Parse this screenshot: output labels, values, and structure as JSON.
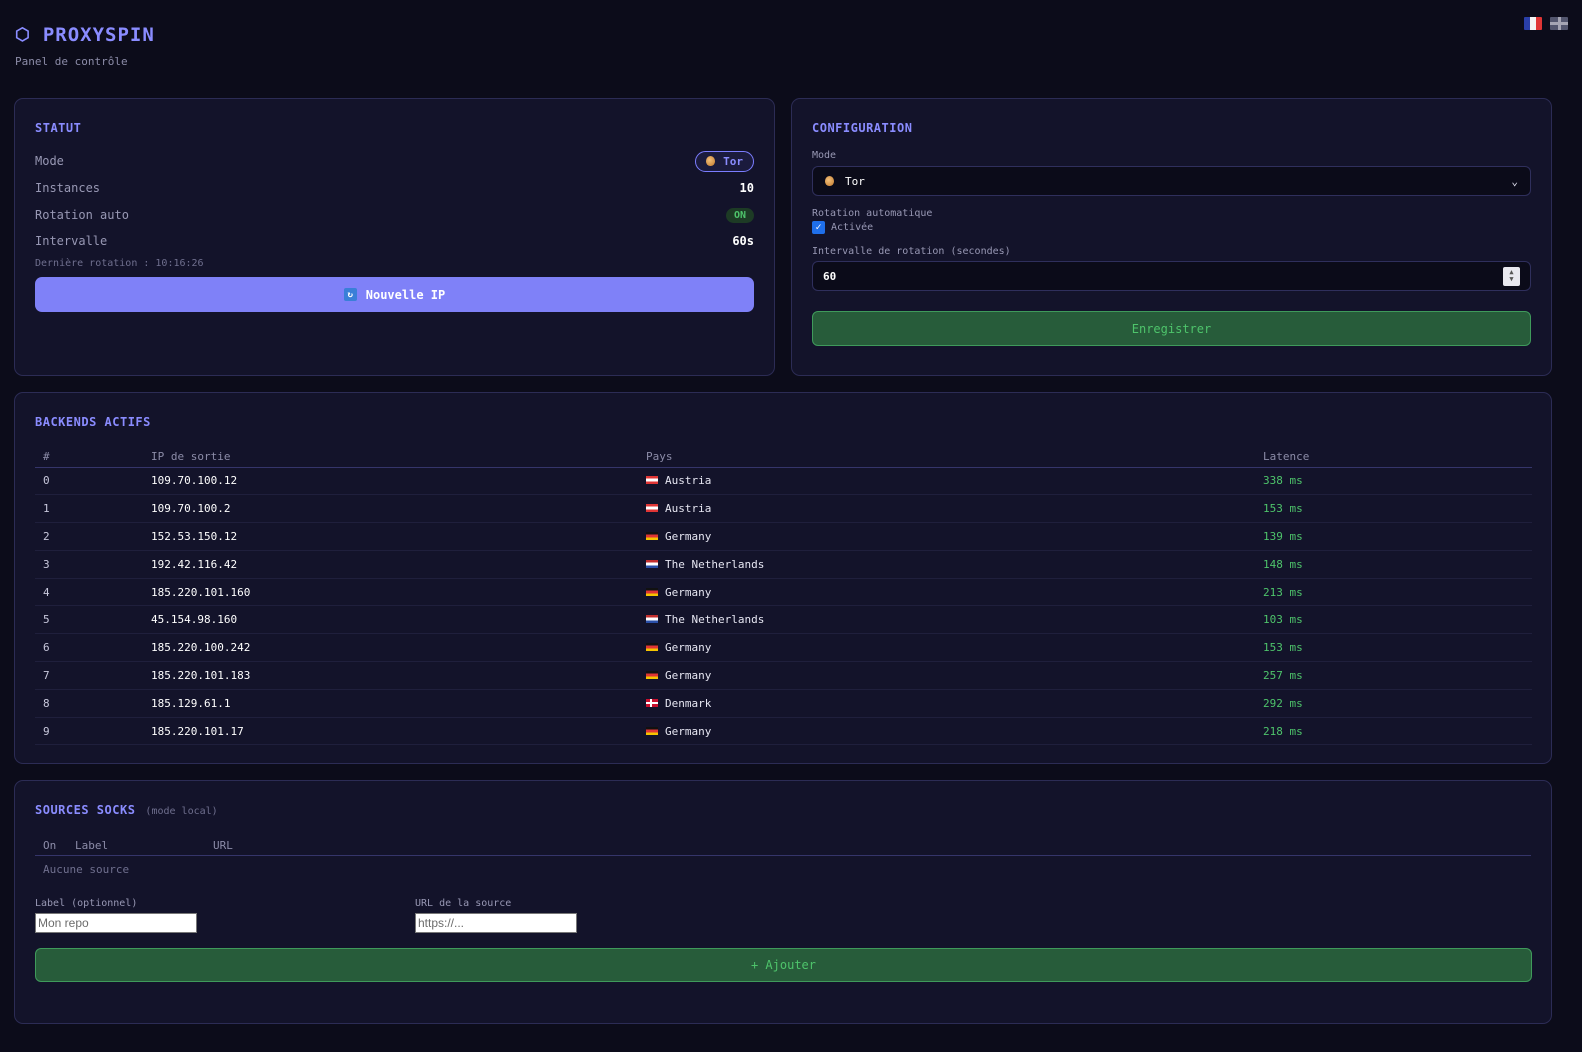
{
  "header": {
    "brand_icon": "⬡",
    "title": "PROXYSPIN",
    "subtitle": "Panel de contrôle",
    "flags": [
      "fr",
      "uk"
    ]
  },
  "statut": {
    "title": "STATUT",
    "rows": {
      "mode_label": "Mode",
      "mode_value": "Tor",
      "instances_label": "Instances",
      "instances_value": "10",
      "rotation_label": "Rotation auto",
      "rotation_value": "ON",
      "interval_label": "Intervalle",
      "interval_value": "60s"
    },
    "last_rotation": "Dernière rotation : 10:16:26",
    "new_ip_button": "Nouvelle IP"
  },
  "config": {
    "title": "CONFIGURATION",
    "mode_label": "Mode",
    "mode_selected": "Tor",
    "rotation_label": "Rotation automatique",
    "rotation_checkbox_label": "Activée",
    "rotation_checked": true,
    "interval_label": "Intervalle de rotation (secondes)",
    "interval_value": "60",
    "save_button": "Enregistrer"
  },
  "backends": {
    "title": "BACKENDS ACTIFS",
    "columns": [
      "#",
      "IP de sortie",
      "Pays",
      "Latence"
    ],
    "rows": [
      {
        "idx": "0",
        "ip": "109.70.100.12",
        "country": "Austria",
        "flag": "at",
        "latency": "338 ms"
      },
      {
        "idx": "1",
        "ip": "109.70.100.2",
        "country": "Austria",
        "flag": "at",
        "latency": "153 ms"
      },
      {
        "idx": "2",
        "ip": "152.53.150.12",
        "country": "Germany",
        "flag": "de",
        "latency": "139 ms"
      },
      {
        "idx": "3",
        "ip": "192.42.116.42",
        "country": "The Netherlands",
        "flag": "nl",
        "latency": "148 ms"
      },
      {
        "idx": "4",
        "ip": "185.220.101.160",
        "country": "Germany",
        "flag": "de",
        "latency": "213 ms"
      },
      {
        "idx": "5",
        "ip": "45.154.98.160",
        "country": "The Netherlands",
        "flag": "nl",
        "latency": "103 ms"
      },
      {
        "idx": "6",
        "ip": "185.220.100.242",
        "country": "Germany",
        "flag": "de",
        "latency": "153 ms"
      },
      {
        "idx": "7",
        "ip": "185.220.101.183",
        "country": "Germany",
        "flag": "de",
        "latency": "257 ms"
      },
      {
        "idx": "8",
        "ip": "185.129.61.1",
        "country": "Denmark",
        "flag": "dk",
        "latency": "292 ms"
      },
      {
        "idx": "9",
        "ip": "185.220.101.17",
        "country": "Germany",
        "flag": "de",
        "latency": "218 ms"
      }
    ]
  },
  "sources": {
    "title": "SOURCES SOCKS",
    "title_note": "(mode local)",
    "columns": [
      "On",
      "Label",
      "URL"
    ],
    "empty_text": "Aucune source",
    "label_field_label": "Label (optionnel)",
    "label_placeholder": "Mon repo",
    "url_field_label": "URL de la source",
    "url_placeholder": "https://...",
    "add_button": "+ Ajouter"
  },
  "colors": {
    "accent": "#8a8cff",
    "button_primary": "#7f81f8",
    "success": "#4ec46b",
    "success_bg": "#275c3a",
    "background": "#0c0c1a",
    "card": "#13132a"
  }
}
